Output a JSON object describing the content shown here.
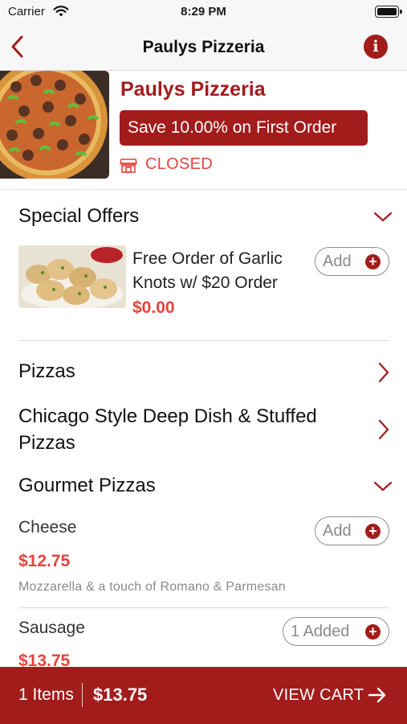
{
  "status_bar": {
    "carrier": "Carrier",
    "time": "8:29 PM"
  },
  "nav": {
    "title": "Paulys Pizzeria"
  },
  "restaurant": {
    "name": "Paulys Pizzeria",
    "promo": "Save 10.00% on First Order",
    "status": "CLOSED"
  },
  "sections": {
    "special_offers": {
      "title": "Special Offers",
      "item": {
        "name": "Free Order of Garlic Knots w/ $20 Order",
        "price": "$0.00",
        "add_label": "Add"
      }
    },
    "pizzas": {
      "title": "Pizzas"
    },
    "deep_dish": {
      "title": "Chicago Style Deep Dish & Stuffed Pizzas"
    },
    "gourmet": {
      "title": "Gourmet Pizzas",
      "items": [
        {
          "name": "Cheese",
          "price": "$12.75",
          "description": "Mozzarella & a touch of Romano & Parmesan",
          "add_label": "Add"
        },
        {
          "name": "Sausage",
          "price": "$13.75",
          "add_label": "1 Added"
        }
      ]
    }
  },
  "cart": {
    "count": "1 Items",
    "total": "$13.75",
    "action": "VIEW CART"
  },
  "colors": {
    "brand": "#a21c1c",
    "price": "#e5433d"
  }
}
